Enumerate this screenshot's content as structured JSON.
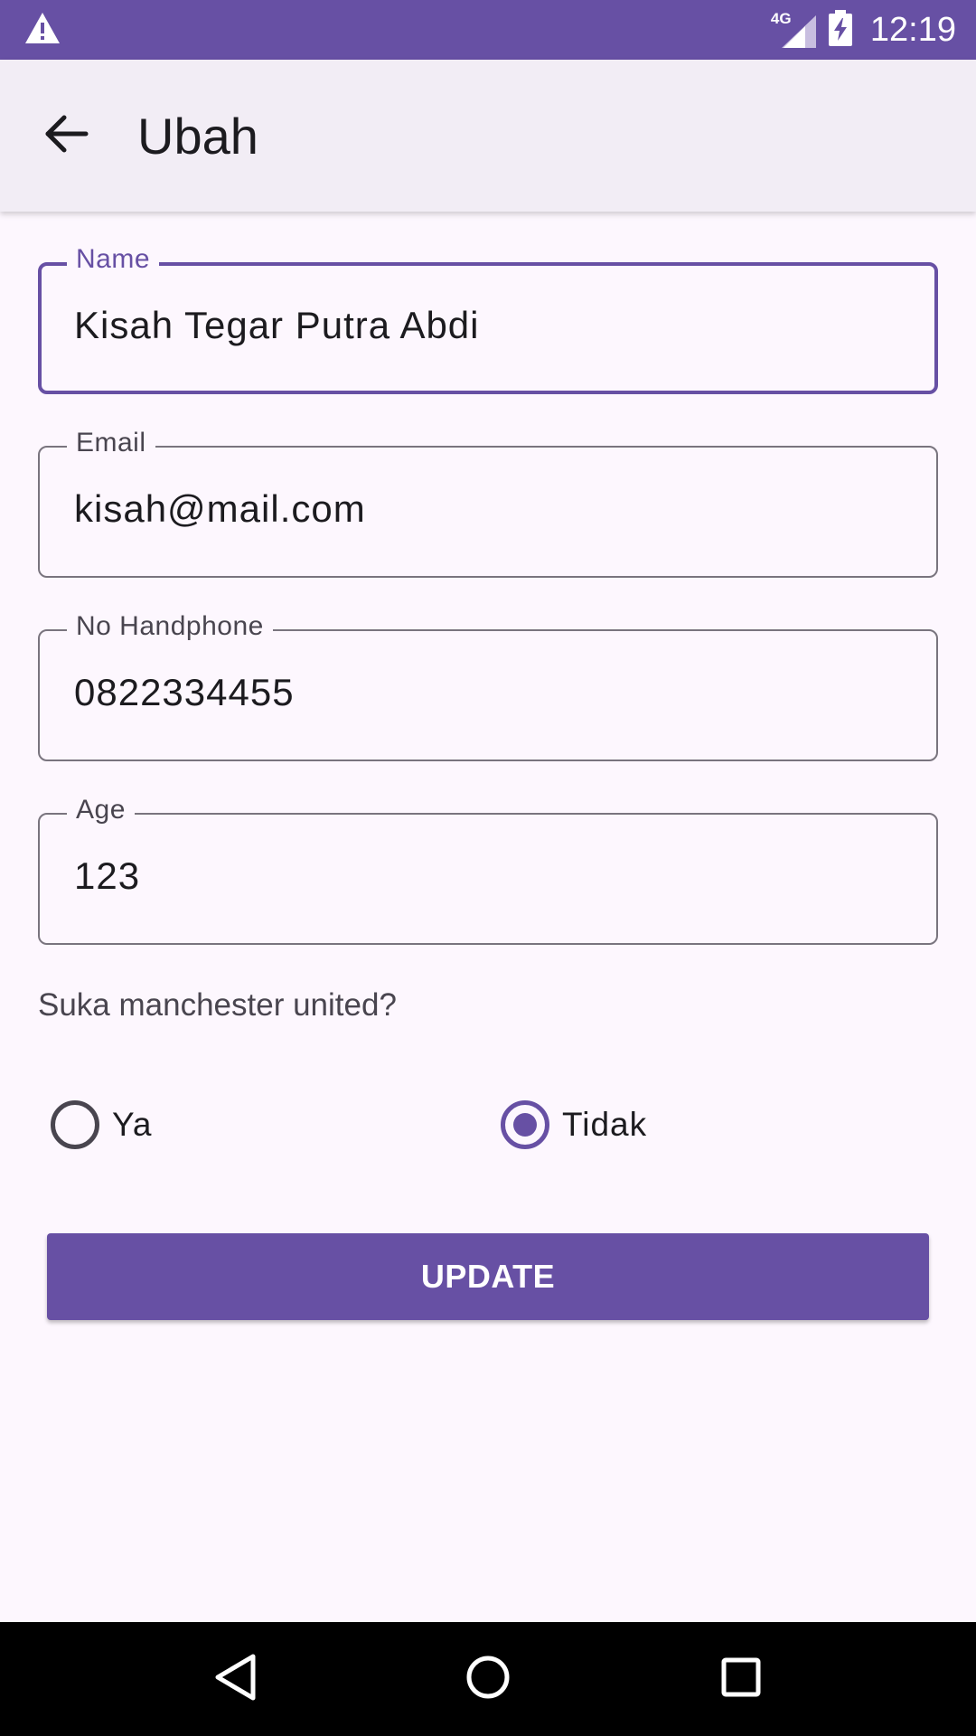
{
  "status_bar": {
    "network_type": "4G",
    "time": "12:19",
    "icons": [
      "warning-icon",
      "signal-icon",
      "battery-charging-icon"
    ]
  },
  "app_bar": {
    "title": "Ubah",
    "back_icon": "arrow-back-icon"
  },
  "form": {
    "name": {
      "label": "Name",
      "value": "Kisah Tegar Putra Abdi"
    },
    "email": {
      "label": "Email",
      "value": "kisah@mail.com"
    },
    "phone": {
      "label": "No Handphone",
      "value": "0822334455"
    },
    "age": {
      "label": "Age",
      "value": "123"
    },
    "question": "Suka manchester united?",
    "options": [
      {
        "label": "Ya",
        "selected": false
      },
      {
        "label": "Tidak",
        "selected": true
      }
    ],
    "update_label": "UPDATE"
  },
  "nav_bar": {
    "icons": [
      "back-triangle-icon",
      "home-circle-icon",
      "recents-square-icon"
    ]
  },
  "colors": {
    "primary": "#6750a4",
    "background": "#fdf7fe",
    "app_bar": "#f2edf5"
  }
}
